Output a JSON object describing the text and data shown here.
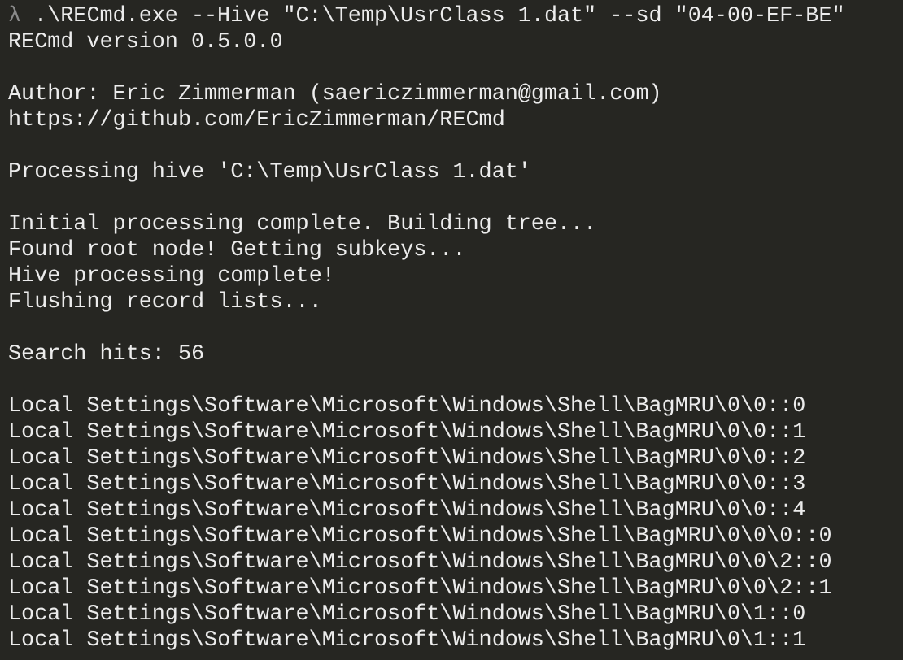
{
  "prompt": {
    "symbol": "λ",
    "command": ".\\RECmd.exe --Hive \"C:\\Temp\\UsrClass 1.dat\" --sd \"04-00-EF-BE\""
  },
  "output_blocks": [
    [
      "RECmd version 0.5.0.0"
    ],
    [
      "Author: Eric Zimmerman (saericzimmerman@gmail.com)",
      "https://github.com/EricZimmerman/RECmd"
    ],
    [
      "Processing hive 'C:\\Temp\\UsrClass 1.dat'"
    ],
    [
      "Initial processing complete. Building tree...",
      "Found root node! Getting subkeys...",
      "Hive processing complete!",
      "Flushing record lists..."
    ],
    [
      "Search hits: 56"
    ],
    [
      "Local Settings\\Software\\Microsoft\\Windows\\Shell\\BagMRU\\0\\0::0",
      "Local Settings\\Software\\Microsoft\\Windows\\Shell\\BagMRU\\0\\0::1",
      "Local Settings\\Software\\Microsoft\\Windows\\Shell\\BagMRU\\0\\0::2",
      "Local Settings\\Software\\Microsoft\\Windows\\Shell\\BagMRU\\0\\0::3",
      "Local Settings\\Software\\Microsoft\\Windows\\Shell\\BagMRU\\0\\0::4",
      "Local Settings\\Software\\Microsoft\\Windows\\Shell\\BagMRU\\0\\0\\0::0",
      "Local Settings\\Software\\Microsoft\\Windows\\Shell\\BagMRU\\0\\0\\2::0",
      "Local Settings\\Software\\Microsoft\\Windows\\Shell\\BagMRU\\0\\0\\2::1",
      "Local Settings\\Software\\Microsoft\\Windows\\Shell\\BagMRU\\0\\1::0",
      "Local Settings\\Software\\Microsoft\\Windows\\Shell\\BagMRU\\0\\1::1"
    ]
  ]
}
